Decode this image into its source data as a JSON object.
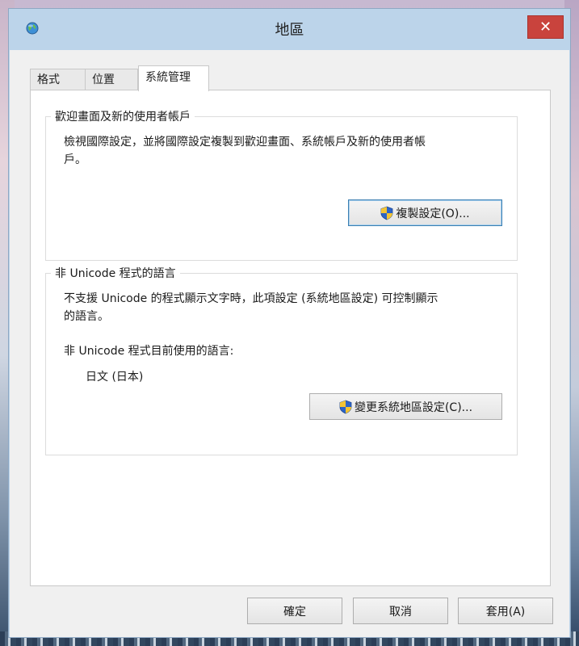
{
  "window": {
    "title": "地區",
    "close_glyph": "✕"
  },
  "tabs": [
    {
      "label": "格式",
      "active": false
    },
    {
      "label": "位置",
      "active": false
    },
    {
      "label": "系統管理",
      "active": true
    }
  ],
  "welcome_group": {
    "title": "歡迎畫面及新的使用者帳戶",
    "description_line1": "檢視國際設定，並將國際設定複製到歡迎畫面、系統帳戶及新的使用者帳",
    "description_line2": "戶。",
    "copy_button_label": "複製設定(O)..."
  },
  "nonunicode_group": {
    "title": "非 Unicode 程式的語言",
    "description_line1": "不支援 Unicode 的程式顯示文字時，此項設定 (系統地區設定) 可控制顯示",
    "description_line2": "的語言。",
    "current_label": "非 Unicode 程式目前使用的語言:",
    "current_value": "日文 (日本)",
    "change_button_label": "變更系統地區設定(C)..."
  },
  "footer": {
    "ok_label": "確定",
    "cancel_label": "取消",
    "apply_label": "套用(A)"
  },
  "icons": {
    "app": "globe-icon",
    "shield": "uac-shield-icon"
  }
}
